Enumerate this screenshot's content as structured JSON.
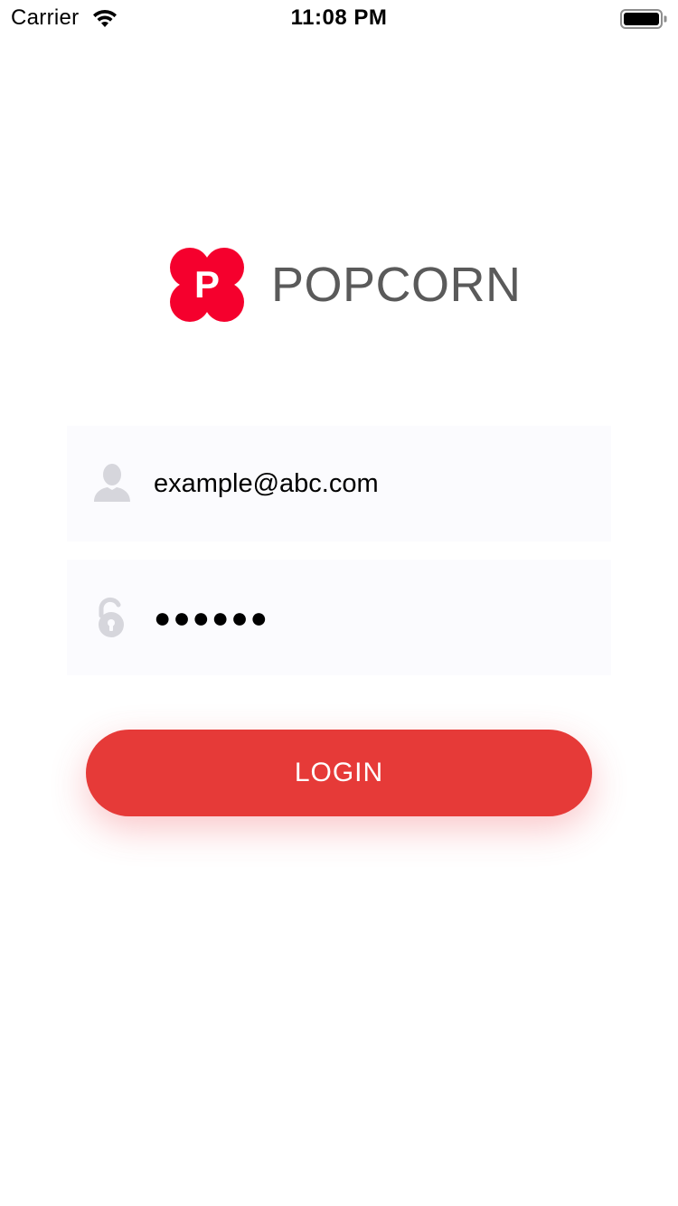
{
  "status_bar": {
    "carrier": "Carrier",
    "time": "11:08 PM",
    "wifi_icon": "wifi-icon",
    "battery_icon": "battery-icon"
  },
  "logo": {
    "mark_letter": "P",
    "app_name": "POPCORN",
    "brand_color": "#f5002d",
    "text_color": "#5a5a5a"
  },
  "login_form": {
    "email": {
      "icon": "user-icon",
      "value": "example@abc.com"
    },
    "password": {
      "icon": "unlock-icon",
      "value": "●●●●●●"
    },
    "login_button": {
      "label": "LOGIN",
      "color": "#e63a38"
    }
  }
}
